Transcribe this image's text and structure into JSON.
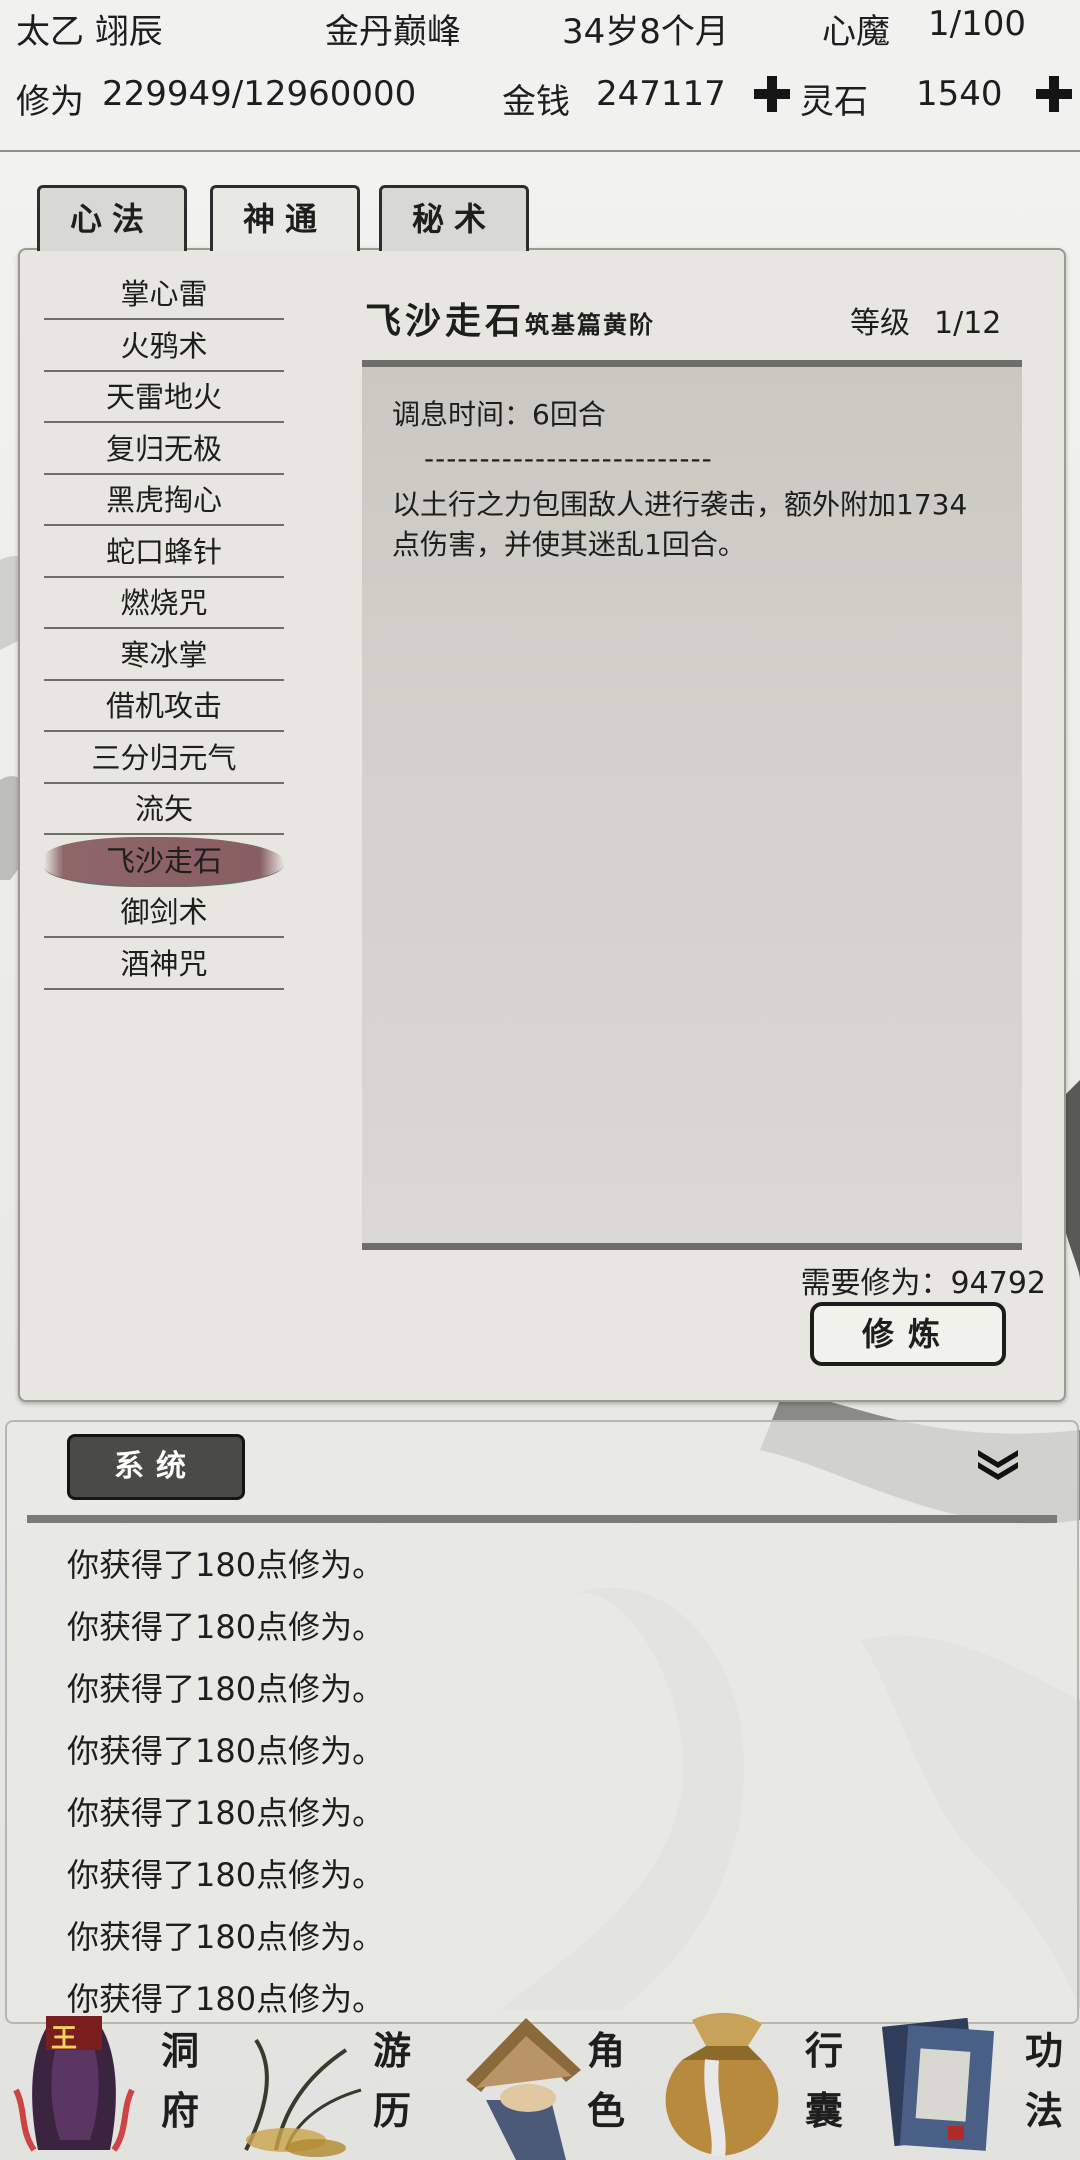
{
  "header": {
    "player_name": "太乙 翊辰",
    "realm": "金丹巅峰",
    "age": "34岁8个月",
    "heart_demon_label": "心魔",
    "heart_demon_value": "1/100",
    "cultivation_label": "修为",
    "cultivation_value": "229949/12960000",
    "money_label": "金钱",
    "money_value": "247117",
    "spirit_stone_label": "灵石",
    "spirit_stone_value": "1540"
  },
  "tabs": [
    {
      "label": "心法",
      "active": false
    },
    {
      "label": "神通",
      "active": true
    },
    {
      "label": "秘术",
      "active": false
    }
  ],
  "skills": [
    "掌心雷",
    "火鸦术",
    "天雷地火",
    "复归无极",
    "黑虎掏心",
    "蛇口蜂针",
    "燃烧咒",
    "寒冰掌",
    "借机攻击",
    "三分归元气",
    "流矢",
    "飞沙走石",
    "御剑术",
    "酒神咒"
  ],
  "selected_skill_index": 11,
  "detail": {
    "title": "飞沙走石",
    "subtitle": "筑基篇黄阶",
    "level_label": "等级",
    "level_value": "1/12",
    "rest_time": "调息时间：6回合",
    "separator": "--------------------------",
    "description": "以土行之力包围敌人进行袭击，额外附加1734点伤害，并使其迷乱1回合。",
    "required": "需要修为：94792",
    "cultivate_button": "修炼"
  },
  "log": {
    "tab_label": "系统",
    "lines": [
      "你获得了180点修为。",
      "你获得了180点修为。",
      "你获得了180点修为。",
      "你获得了180点修为。",
      "你获得了180点修为。",
      "你获得了180点修为。",
      "你获得了180点修为。",
      "你获得了180点修为。"
    ]
  },
  "nav": [
    {
      "label1": "洞",
      "label2": "府",
      "badge": "王"
    },
    {
      "label1": "游",
      "label2": "历"
    },
    {
      "label1": "角",
      "label2": "色"
    },
    {
      "label1": "行",
      "label2": "囊"
    },
    {
      "label1": "功",
      "label2": "法"
    }
  ],
  "colors": {
    "selected_skill": "#7a464b",
    "panel_bg": "#e7e7e0",
    "dark_tab": "#4a4a47"
  }
}
